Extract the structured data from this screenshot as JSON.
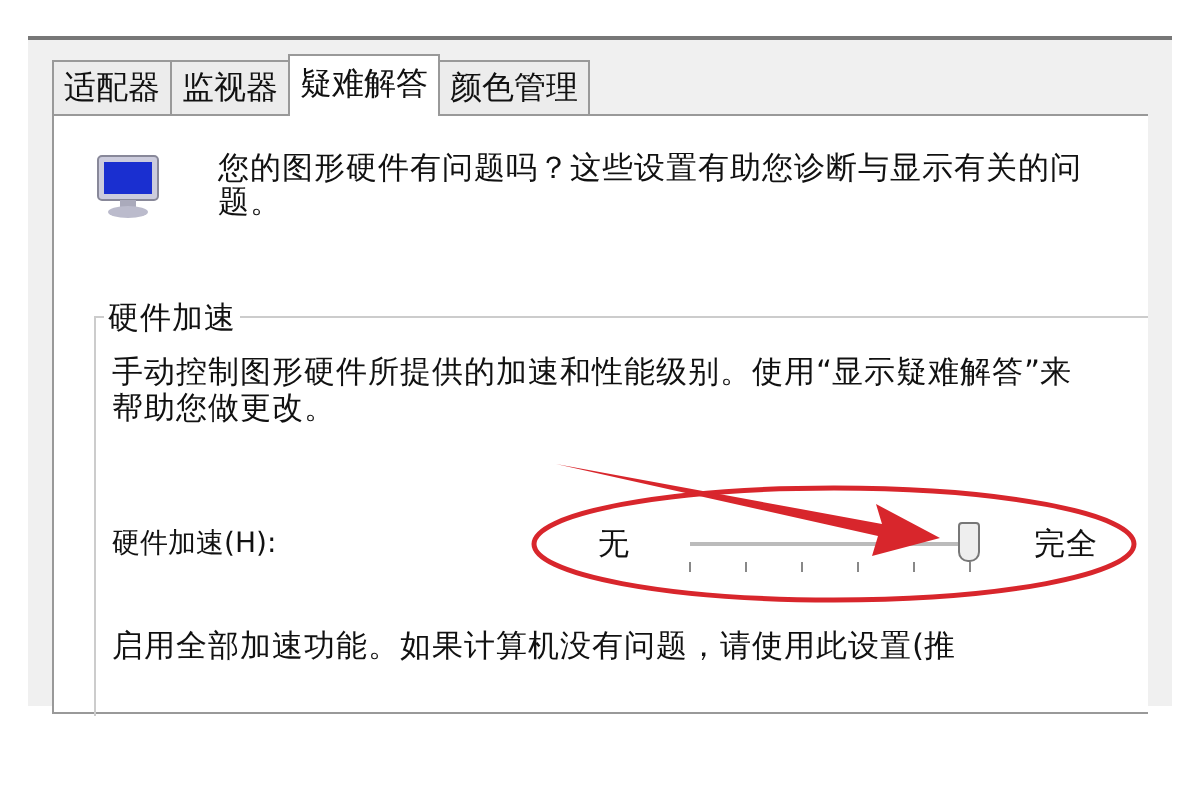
{
  "tabs": [
    {
      "label": "适配器",
      "selected": false
    },
    {
      "label": "监视器",
      "selected": false
    },
    {
      "label": "疑难解答",
      "selected": true
    },
    {
      "label": "颜色管理",
      "selected": false
    }
  ],
  "intro": {
    "text": "您的图形硬件有问题吗？这些设置有助您诊断与显示有关的问题。"
  },
  "group": {
    "title": "硬件加速",
    "description": "手动控制图形硬件所提供的加速和性能级别。使用“显示疑难解答”来帮助您做更改。",
    "slider": {
      "label": "硬件加速(H):",
      "min_label": "无",
      "max_label": "完全",
      "level": 1
    },
    "note": "启用全部加速功能。如果计算机没有问题，请使用此设置(推"
  }
}
